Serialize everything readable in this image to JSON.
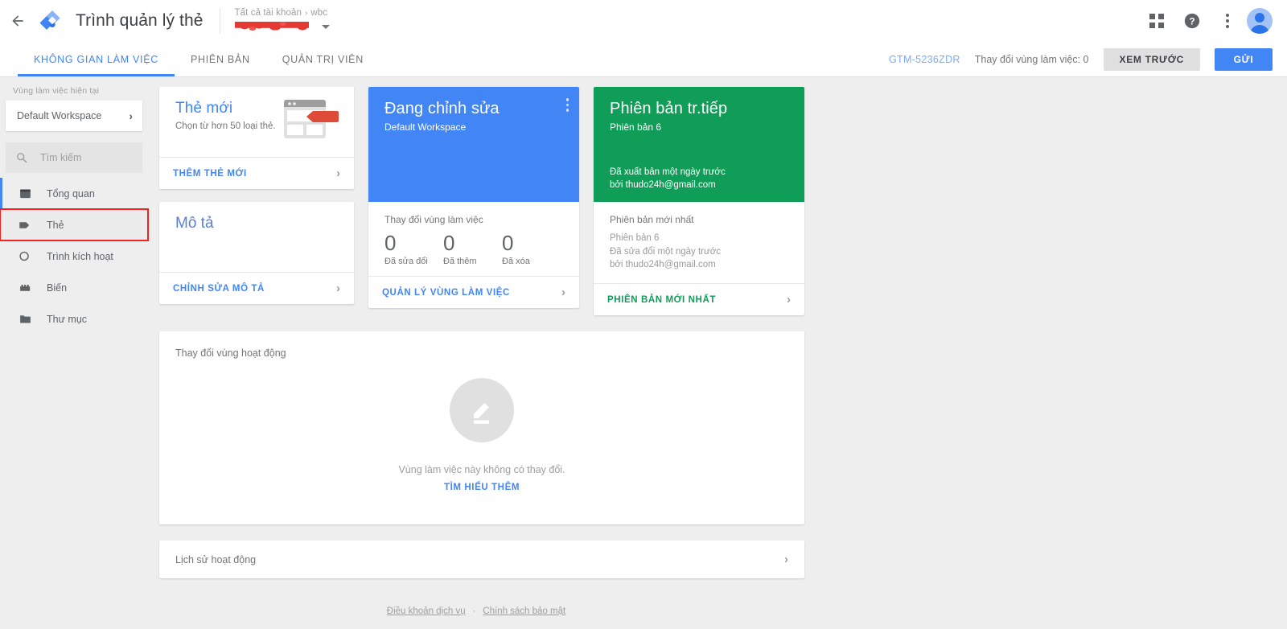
{
  "topbar": {
    "back_icon": "arrow-left-icon",
    "logo_icon": "gtm-diamond-logo",
    "app_title": "Trình quản lý thẻ",
    "breadcrumb_root": "Tất cả tài khoản",
    "breadcrumb_sep": "›",
    "breadcrumb_current": "wbc",
    "account_name_redacted": "",
    "apps_icon": "apps-grid-icon",
    "help_icon": "help-circle-icon",
    "more_icon": "kebab-menu-icon",
    "avatar_icon": "user-avatar-icon"
  },
  "navbar": {
    "tabs": [
      {
        "label": "KHÔNG GIAN LÀM VIỆC",
        "active": true
      },
      {
        "label": "PHIÊN BẢN",
        "active": false
      },
      {
        "label": "QUẢN TRỊ VIÊN",
        "active": false
      }
    ],
    "container_id": "GTM-5236ZDR",
    "workspace_changes": "Thay đổi vùng làm việc: 0",
    "preview_button": "XEM TRƯỚC",
    "submit_button": "GỬI"
  },
  "sidebar": {
    "workspace_label": "Vùng làm việc hiện tại",
    "workspace_name": "Default Workspace",
    "search_placeholder": "Tìm kiếm",
    "items": [
      {
        "label": "Tổng quan",
        "icon": "overview-box-icon",
        "current": true,
        "highlight": false
      },
      {
        "label": "Thẻ",
        "icon": "tag-icon",
        "current": false,
        "highlight": true
      },
      {
        "label": "Trình kích hoạt",
        "icon": "trigger-circle-icon",
        "current": false,
        "highlight": false
      },
      {
        "label": "Biến",
        "icon": "variables-icon",
        "current": false,
        "highlight": false
      },
      {
        "label": "Thư mục",
        "icon": "folder-icon",
        "current": false,
        "highlight": false
      }
    ]
  },
  "cards": {
    "new_tag": {
      "title": "Thẻ mới",
      "subtitle": "Chọn từ hơn 50 loại thẻ.",
      "action": "THÊM THẺ MỚI",
      "illustration_icon": "browser-window-with-tag-illustration"
    },
    "description": {
      "title": "Mô tả",
      "action": "CHỈNH SỬA MÔ TẢ"
    },
    "workspace": {
      "title": "Đang chỉnh sửa",
      "subtitle": "Default Workspace",
      "menu_icon": "kebab-menu-icon",
      "stats_header": "Thay đổi vùng làm việc",
      "stats": [
        {
          "value": "0",
          "caption": "Đã sửa đổi"
        },
        {
          "value": "0",
          "caption": "Đã thêm"
        },
        {
          "value": "0",
          "caption": "Đã xóa"
        }
      ],
      "action": "QUẢN LÝ VÙNG LÀM VIỆC"
    },
    "version": {
      "title": "Phiên bản tr.tiếp",
      "subtitle": "Phiên bản 6",
      "published_line1": "Đã xuất bản một ngày trước",
      "published_line2": "bởi thudo24h@gmail.com",
      "latest_header": "Phiên bản mới nhất",
      "latest_line1": "Phiên bản 6",
      "latest_line2": "Đã sửa đổi một ngày trước",
      "latest_line3": "bởi thudo24h@gmail.com",
      "action": "PHIÊN BẢN MỚI NHẤT"
    }
  },
  "activity": {
    "panel_title": "Thay đổi vùng hoạt động",
    "empty_icon": "pencil-edit-icon",
    "empty_message": "Vùng làm việc này không có thay đổi.",
    "empty_link": "TÌM HIỂU THÊM"
  },
  "history": {
    "title": "Lịch sử hoạt động"
  },
  "footer": {
    "terms": "Điều khoản dịch vụ",
    "separator": "·",
    "privacy": "Chính sách bảo mật"
  },
  "colors": {
    "blue": "#4285f4",
    "green": "#0f9d58",
    "red_highlight": "#f4211e",
    "grey_bg": "#eeeeee"
  }
}
